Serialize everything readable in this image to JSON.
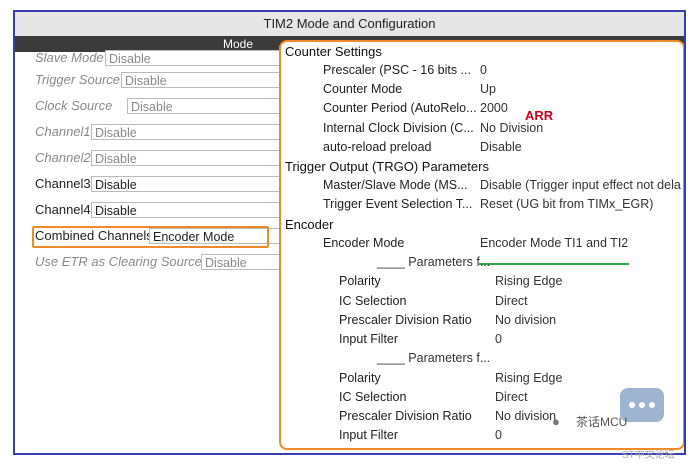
{
  "window": {
    "title": "TIM2 Mode and Configuration",
    "mode_label": "Mode"
  },
  "left": {
    "slave_mode": {
      "label": "Slave Mode",
      "value": "Disable"
    },
    "trigger_source": {
      "label": "Trigger Source",
      "value": "Disable"
    },
    "clock_source": {
      "label": "Clock Source",
      "value": "Disable"
    },
    "channel1": {
      "label": "Channel1",
      "value": "Disable"
    },
    "channel2": {
      "label": "Channel2",
      "value": "Disable"
    },
    "channel3": {
      "label": "Channel3",
      "value": "Disable"
    },
    "channel4": {
      "label": "Channel4",
      "value": "Disable"
    },
    "combined": {
      "label": "Combined Channels",
      "value": "Encoder Mode"
    },
    "etr": {
      "label": "Use ETR as Clearing Source",
      "value": "Disable"
    }
  },
  "panel": {
    "counter_settings": "Counter Settings",
    "prescaler": {
      "key": "Prescaler (PSC - 16 bits ...",
      "value": "0"
    },
    "counter_mode": {
      "key": "Counter Mode",
      "value": "Up"
    },
    "counter_period": {
      "key": "Counter Period (AutoRelo...",
      "value": "2000"
    },
    "arr_annotation": "ARR",
    "internal_clock": {
      "key": "Internal Clock Division (C...",
      "value": "No Division"
    },
    "auto_reload": {
      "key": "auto-reload preload",
      "value": "Disable"
    },
    "trgo": "Trigger Output (TRGO) Parameters",
    "master_slave": {
      "key": "Master/Slave Mode (MS...",
      "value": "Disable (Trigger input effect not dela"
    },
    "trigger_event": {
      "key": "Trigger Event Selection T...",
      "value": "Reset (UG bit from TIMx_EGR)"
    },
    "encoder": "Encoder",
    "encoder_mode": {
      "key": "Encoder Mode",
      "value": "Encoder Mode TI1 and TI2"
    },
    "params1": "____ Parameters f...",
    "polarity1": {
      "key": "Polarity",
      "value": "Rising Edge"
    },
    "ic_sel1": {
      "key": "IC Selection",
      "value": "Direct"
    },
    "psc_div1": {
      "key": "Prescaler Division Ratio",
      "value": "No division"
    },
    "filter1": {
      "key": "Input Filter",
      "value": "0"
    },
    "params2": "____ Parameters f...",
    "polarity2": {
      "key": "Polarity",
      "value": "Rising Edge"
    },
    "ic_sel2": {
      "key": "IC Selection",
      "value": "Direct"
    },
    "psc_div2": {
      "key": "Prescaler Division Ratio",
      "value": "No division"
    },
    "filter2": {
      "key": "Input Filter",
      "value": "0"
    }
  },
  "watermark": {
    "text": "茶话MCU",
    "sub": "ST中文论坛"
  }
}
